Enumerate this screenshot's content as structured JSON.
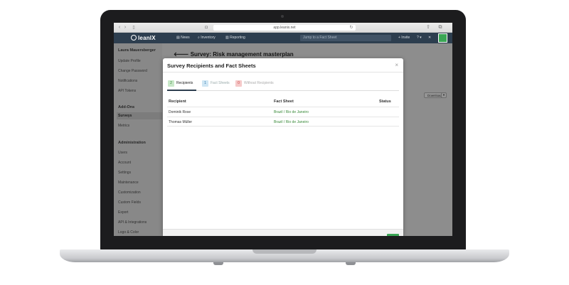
{
  "browser": {
    "url": "app.leanix.net",
    "back_glyph": "‹",
    "forward_glyph": "›",
    "sidebar_glyph": "▯",
    "reload_glyph": "↻",
    "share_glyph": "⇧",
    "tabs_glyph": "⧉",
    "shield_glyph": "◘"
  },
  "appbar": {
    "logo_text": "leanIX",
    "nav": [
      {
        "label": "News",
        "icon": "news-icon",
        "glyph": "▤"
      },
      {
        "label": "Inventory",
        "icon": "search-icon",
        "glyph": "⌕"
      },
      {
        "label": "Reporting",
        "icon": "chart-icon",
        "glyph": "▥"
      }
    ],
    "jump_placeholder": "Jump to a Fact Sheet",
    "invite_label": "+ Invite",
    "help_label": "? ▾",
    "settings_glyph": "✕"
  },
  "sidebar": {
    "user_name": "Laura Mauersberger",
    "user_items": [
      "Update Profile",
      "Change Password",
      "Notifications",
      "API Tokens"
    ],
    "addons_heading": "Add-Ons",
    "addons_items": [
      "Surveys",
      "Metrics"
    ],
    "active_item": "Surveys",
    "admin_heading": "Administration",
    "admin_items": [
      "Users",
      "Account",
      "Settings",
      "Maintenance",
      "Customization",
      "Custom Fields",
      "Export",
      "API & Integrations",
      "Logo & Color"
    ]
  },
  "main": {
    "title": "Survey: Risk management masterplan",
    "back_glyph": "🡐",
    "download_label": "Download",
    "download_caret": "▾"
  },
  "modal": {
    "title": "Survey Recipients and Fact Sheets",
    "close_glyph": "×",
    "tabs": [
      {
        "count": "2",
        "label": "Recipients",
        "badge_bg": "#c9e8c9",
        "badge_fg": "#3a8a3a",
        "text_color": "#222"
      },
      {
        "count": "1",
        "label": "Fact Sheets",
        "badge_bg": "#cfe6f4",
        "badge_fg": "#3b7fb0",
        "text_color": "#9aa"
      },
      {
        "count": "0",
        "label": "Without Recipients",
        "badge_bg": "#f5c9c9",
        "badge_fg": "#c44",
        "text_color": "#aaa"
      }
    ],
    "columns": [
      "Recipient",
      "Fact Sheet",
      "Status"
    ],
    "rows": [
      {
        "recipient": "Dominik Rose",
        "fact_sheet": "Brazil / Rio de Janeiro",
        "status": ""
      },
      {
        "recipient": "Thomas Müller",
        "fact_sheet": "Brazil / Rio de Janeiro",
        "status": ""
      }
    ]
  }
}
